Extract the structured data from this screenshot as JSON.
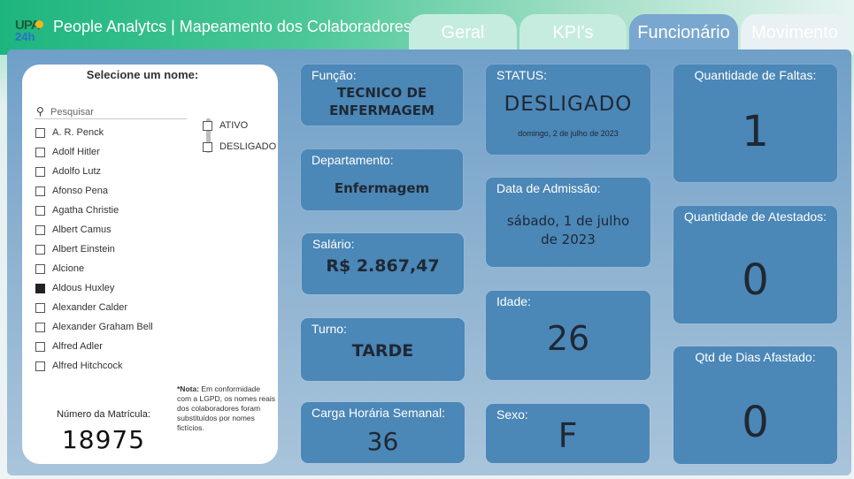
{
  "header": {
    "logo_line1": "UPA",
    "logo_line2": "24h",
    "title": "People Analytcs | Mapeamento dos Colaboradores",
    "tabs": [
      {
        "label": "Geral"
      },
      {
        "label": "KPI's"
      },
      {
        "label": "Funcionário",
        "active": true
      },
      {
        "label": "Movimento"
      }
    ]
  },
  "filter_panel": {
    "title": "Selecione um nome:",
    "search_placeholder": "Pesquisar",
    "names": [
      {
        "label": "A. R. Penck",
        "checked": false
      },
      {
        "label": "Adolf Hitler",
        "checked": false
      },
      {
        "label": "Adolfo Lutz",
        "checked": false
      },
      {
        "label": "Afonso Pena",
        "checked": false
      },
      {
        "label": "Agatha Christie",
        "checked": false
      },
      {
        "label": "Albert Camus",
        "checked": false
      },
      {
        "label": "Albert Einstein",
        "checked": false
      },
      {
        "label": "Alcione",
        "checked": false
      },
      {
        "label": "Aldous Huxley",
        "checked": true
      },
      {
        "label": "Alexander Calder",
        "checked": false
      },
      {
        "label": "Alexander Graham Bell",
        "checked": false
      },
      {
        "label": "Alfred Adler",
        "checked": false
      },
      {
        "label": "Alfred Hitchcock",
        "checked": false
      }
    ],
    "status_options": [
      {
        "label": "ATIVO",
        "checked": false
      },
      {
        "label": "DESLIGADO",
        "checked": false
      }
    ],
    "note_bold": "*Nota:",
    "note_text": " Em conformidade com a LGPD, os nomes reais dos colaboradores foram substituídos por nomes fictícios.",
    "matricula_label": "Número da Matrícula:",
    "matricula_value": "18975"
  },
  "cards": {
    "funcao": {
      "label": "Função:",
      "value_line1": "TECNICO DE",
      "value_line2": "ENFERMAGEM"
    },
    "departamento": {
      "label": "Departamento:",
      "value": "Enfermagem"
    },
    "salario": {
      "label": "Salário:",
      "value": "R$ 2.867,47"
    },
    "turno": {
      "label": "Turno:",
      "value": "TARDE"
    },
    "carga": {
      "label": "Carga Horária Semanal:",
      "value": "36"
    },
    "status": {
      "label": "STATUS:",
      "value": "DESLIGADO",
      "date": "domingo, 2 de julho de 2023"
    },
    "admissao": {
      "label": "Data de Admissão:",
      "value_line1": "sábado, 1 de julho",
      "value_line2": "de 2023"
    },
    "idade": {
      "label": "Idade:",
      "value": "26"
    },
    "sexo": {
      "label": "Sexo:",
      "value": "F"
    },
    "faltas": {
      "label": "Quantidade de Faltas:",
      "value": "1"
    },
    "atestados": {
      "label": "Quantidade de Atestados:",
      "value": "0"
    },
    "afastado": {
      "label": "Qtd de Dias Afastado:",
      "value": "0"
    }
  }
}
